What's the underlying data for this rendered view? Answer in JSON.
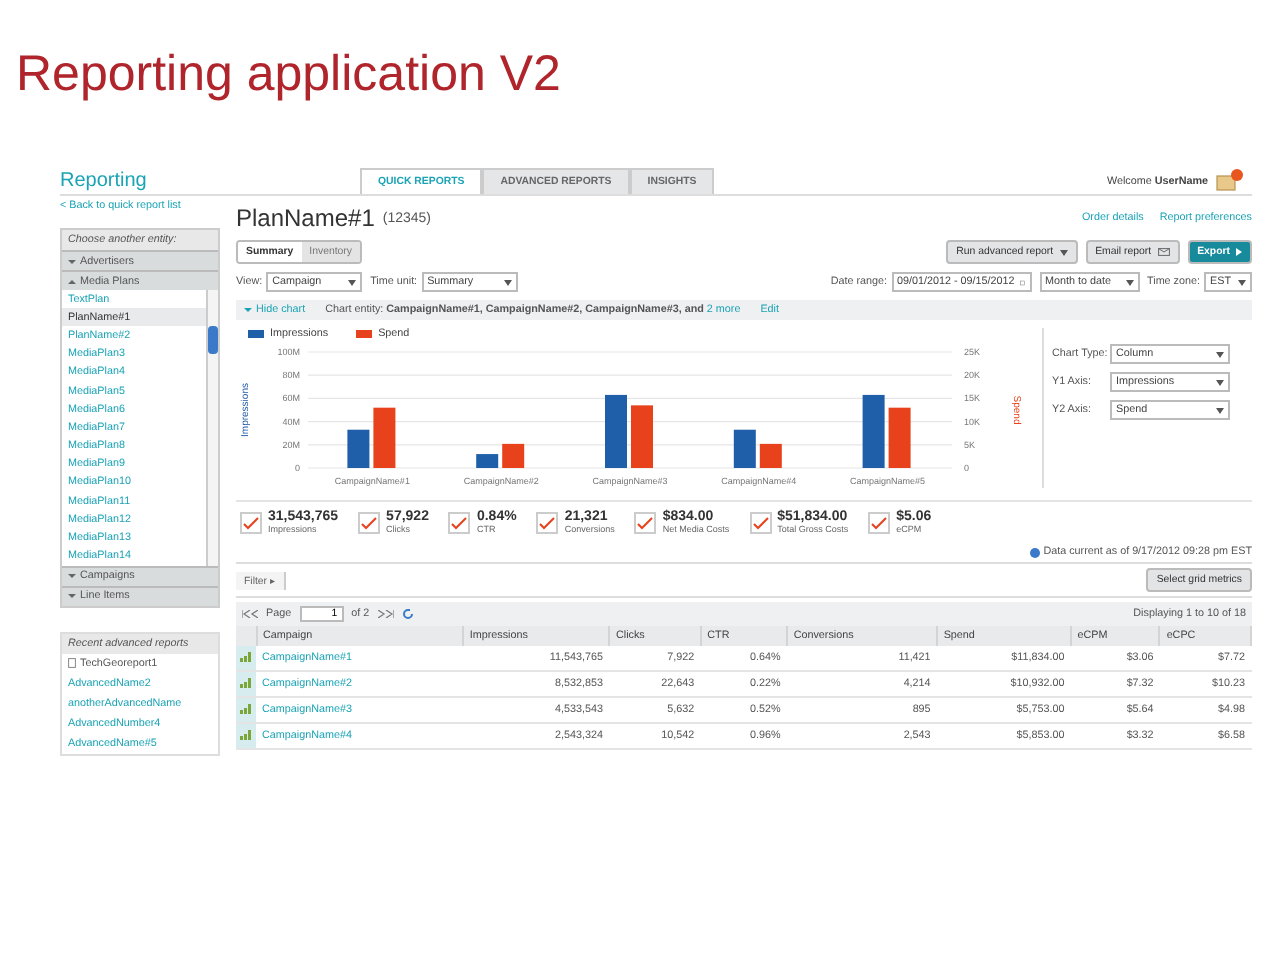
{
  "slide": {
    "title": "Reporting application V2"
  },
  "app": {
    "logo": "Reporting",
    "back_link": "< Back to quick report list",
    "tabs": [
      {
        "label": "QUICK REPORTS",
        "selected": true
      },
      {
        "label": "ADVANCED REPORTS",
        "selected": false
      },
      {
        "label": "INSIGHTS",
        "selected": false
      }
    ],
    "welcome": "Welcome",
    "user": "UserName"
  },
  "sidebar": {
    "entity_label": "Choose another entity:",
    "sections": [
      {
        "label": "Advertisers",
        "expanded": false
      },
      {
        "label": "Media Plans",
        "expanded": true,
        "items": [
          {
            "label": "TextPlan",
            "selected": false
          },
          {
            "label": "PlanName#1",
            "selected": true
          },
          {
            "label": "PlanName#2",
            "selected": false
          },
          {
            "label": "MediaPlan3",
            "selected": false
          },
          {
            "label": "MediaPlan4",
            "selected": false
          },
          {
            "label": "MediaPlan5",
            "selected": false
          },
          {
            "label": "MediaPlan6",
            "selected": false
          },
          {
            "label": "MediaPlan7",
            "selected": false
          },
          {
            "label": "MediaPlan8",
            "selected": false
          },
          {
            "label": "MediaPlan9",
            "selected": false
          },
          {
            "label": "MediaPlan10",
            "selected": false
          },
          {
            "label": "MediaPlan11",
            "selected": false
          },
          {
            "label": "MediaPlan12",
            "selected": false
          },
          {
            "label": "MediaPlan13",
            "selected": false
          },
          {
            "label": "MediaPlan14",
            "selected": false
          }
        ]
      },
      {
        "label": "Campaigns",
        "expanded": false
      },
      {
        "label": "Line Items",
        "expanded": false
      }
    ],
    "recent": {
      "title": "Recent advanced reports",
      "items": [
        {
          "label": "TechGeoreport1",
          "kind": "report"
        },
        {
          "label": "AdvancedName2",
          "kind": "link"
        },
        {
          "label": "anotherAdvancedName",
          "kind": "link"
        },
        {
          "label": "AdvancedNumber4",
          "kind": "link"
        },
        {
          "label": "AdvancedName#5",
          "kind": "link"
        }
      ]
    }
  },
  "header": {
    "plan_name": "PlanName#1",
    "plan_id": "(12345)",
    "links": [
      "Order details",
      "Report preferences"
    ],
    "view_tabs": [
      {
        "label": "Summary",
        "selected": true
      },
      {
        "label": "Inventory",
        "selected": false
      }
    ],
    "run_advanced": "Run advanced report",
    "email": "Email report",
    "export": "Export"
  },
  "filters": {
    "left": [
      {
        "label": "View:",
        "value": "Campaign"
      },
      {
        "label": "Time unit:",
        "value": "Summary"
      }
    ],
    "date_label": "Date range:",
    "date_value": "09/01/2012 - 09/15/2012",
    "period": "Month to date",
    "timezone_label": "Time zone:",
    "timezone": "EST"
  },
  "chart_bar": {
    "toggle": "Hide chart",
    "expanded": true,
    "entity_label": "Chart entity:",
    "entities": "CampaignName#1, CampaignName#2, CampaignName#3, and",
    "more": "2 more",
    "edit": "Edit"
  },
  "chart": {
    "chart_data": {
      "type": "bar",
      "stacked": false,
      "grid": true,
      "ylabel": "Impressions",
      "y2label": "Spend",
      "ylim": [
        0,
        100
      ],
      "y2lim": [
        0,
        25000
      ],
      "categories": [
        "CampaignName#1",
        "CampaignName#2",
        "CampaignName#3",
        "CampaignName#4",
        "CampaignName#5"
      ],
      "series": [
        {
          "name": "Impressions",
          "color": "#1f5ea8",
          "values": [
            33,
            12,
            63,
            33,
            63
          ]
        },
        {
          "name": "Spend",
          "color": "#e8421d",
          "axis": "y2",
          "values": [
            13000,
            5200,
            13500,
            5200,
            13000
          ]
        }
      ],
      "yticks": [
        {
          "value": 0,
          "label": "0"
        },
        {
          "value": 20,
          "label": "20M"
        },
        {
          "value": 40,
          "label": "40M"
        },
        {
          "value": 60,
          "label": "60M"
        },
        {
          "value": 80,
          "label": "80M"
        },
        {
          "value": 100,
          "label": "100M"
        }
      ],
      "y2ticks": [
        {
          "value": 0,
          "label": "0"
        },
        {
          "value": 5000,
          "label": "5K"
        },
        {
          "value": 10000,
          "label": "10K"
        },
        {
          "value": 15000,
          "label": "15K"
        },
        {
          "value": 20000,
          "label": "20K"
        },
        {
          "value": 25000,
          "label": "25K"
        }
      ]
    },
    "settings": [
      {
        "label": "Chart Type:",
        "value": "Column"
      },
      {
        "label": "Y1 Axis:",
        "value": "Impressions"
      },
      {
        "label": "Y2 Axis:",
        "value": "Spend"
      }
    ]
  },
  "metrics": [
    {
      "value": "31,543,765",
      "label": "Impressions"
    },
    {
      "value": "57,922",
      "label": "Clicks"
    },
    {
      "value": "0.84%",
      "label": "CTR"
    },
    {
      "value": "21,321",
      "label": "Conversions"
    },
    {
      "value": "$834.00",
      "label": "Net Media Costs"
    },
    {
      "value": "$51,834.00",
      "label": "Total Gross Costs"
    },
    {
      "value": "$5.06",
      "label": "eCPM"
    }
  ],
  "data_current": "Data current as of 9/17/2012 09:28 pm EST",
  "grid": {
    "filter": "Filter",
    "filter_arrow": "▸",
    "select_metrics": "Select grid metrics",
    "page_label": "Page",
    "page": "1",
    "page_of": "of 2",
    "displaying": "Displaying 1 to 10 of 18",
    "columns": [
      "Campaign",
      "Impressions",
      "Clicks",
      "CTR",
      "Conversions",
      "Spend",
      "eCPM",
      "eCPC"
    ],
    "rows": [
      [
        "CampaignName#1",
        "11,543,765",
        "7,922",
        "0.64%",
        "11,421",
        "$11,834.00",
        "$3.06",
        "$7.72"
      ],
      [
        "CampaignName#2",
        "8,532,853",
        "22,643",
        "0.22%",
        "4,214",
        "$10,932.00",
        "$7.32",
        "$10.23"
      ],
      [
        "CampaignName#3",
        "4,533,543",
        "5,632",
        "0.52%",
        "895",
        "$5,753.00",
        "$5.64",
        "$4.98"
      ],
      [
        "CampaignName#4",
        "2,543,324",
        "10,542",
        "0.96%",
        "2,543",
        "$5,853.00",
        "$3.32",
        "$6.58"
      ]
    ]
  }
}
